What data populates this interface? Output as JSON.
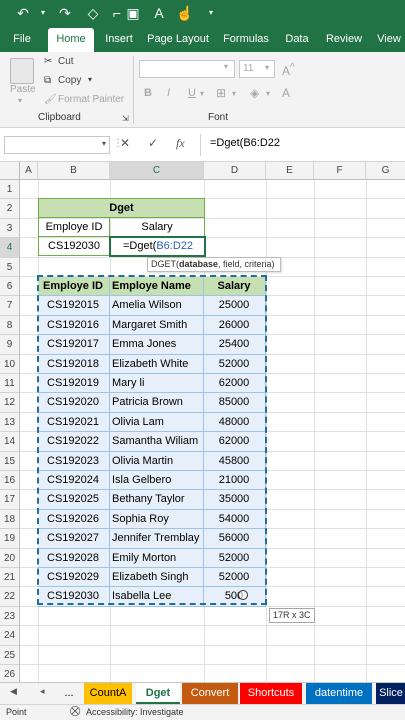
{
  "title_icons": [
    "undo-icon",
    "redo-icon",
    "eraser-icon",
    "format-painter-icon",
    "clear-formatting-icon",
    "save-icon",
    "touch-mode-icon"
  ],
  "tabs": [
    "File",
    "Home",
    "Insert",
    "Page Layout",
    "Formulas",
    "Data",
    "Review",
    "View"
  ],
  "active_tab": "Home",
  "ribbon": {
    "paste": "Paste",
    "cut": "Cut",
    "copy": "Copy",
    "format_painter": "Format Painter",
    "clipboard_label": "Clipboard",
    "font_size": "11",
    "bold": "B",
    "italic": "I",
    "underline": "U",
    "font_label": "Font"
  },
  "formula_bar": {
    "cancel": "✕",
    "enter": "✓",
    "fx": "fx",
    "value": "=Dget(B6:D22"
  },
  "columns": [
    "A",
    "B",
    "C",
    "D",
    "E",
    "F",
    "G"
  ],
  "rows": [
    "1",
    "2",
    "3",
    "4",
    "5",
    "6",
    "7",
    "8",
    "9",
    "10",
    "11",
    "12",
    "13",
    "14",
    "15",
    "16",
    "17",
    "18",
    "19",
    "20",
    "21",
    "22",
    "23",
    "24",
    "25",
    "26"
  ],
  "criteria": {
    "title": "Dget",
    "header_id": "Employe ID",
    "header_salary": "Salary",
    "id_value": "CS192030",
    "formula_prefix": "=Dget(",
    "formula_ref": "B6:D22"
  },
  "tooltip": {
    "func": "DGET(",
    "arg_bold": "database",
    "rest": ", field, criteria)"
  },
  "table": {
    "headers": [
      "Employe ID",
      "Employe Name",
      "Salary"
    ],
    "rows": [
      [
        "CS192015",
        "Amelia Wilson",
        "25000"
      ],
      [
        "CS192016",
        "Margaret Smith",
        "26000"
      ],
      [
        "CS192017",
        "Emma Jones",
        "25400"
      ],
      [
        "CS192018",
        "Elizabeth White",
        "52000"
      ],
      [
        "CS192019",
        "Mary li",
        "62000"
      ],
      [
        "CS192020",
        "Patricia Brown",
        "85000"
      ],
      [
        "CS192021",
        "Olivia Lam",
        "48000"
      ],
      [
        "CS192022",
        "Samantha Wiliam",
        "62000"
      ],
      [
        "CS192023",
        "Olivia Martin",
        "45800"
      ],
      [
        "CS192024",
        "Isla Gelbero",
        "21000"
      ],
      [
        "CS192025",
        "Bethany Taylor",
        "35000"
      ],
      [
        "CS192026",
        "Sophia Roy",
        "54000"
      ],
      [
        "CS192027",
        "Jennifer Tremblay",
        "56000"
      ],
      [
        "CS192028",
        "Emily Morton",
        "52000"
      ],
      [
        "CS192029",
        "Elizabeth Singh",
        "52000"
      ],
      [
        "CS192030",
        "Isabella Lee",
        "500"
      ]
    ]
  },
  "selection_size": "17R x 3C",
  "sheet_tabs": [
    {
      "label": "...",
      "color": "#f3f3f3",
      "text": "#000000"
    },
    {
      "label": "CountA",
      "color": "#ffc000",
      "text": "#000000"
    },
    {
      "label": "Dget",
      "color": "#ffffff",
      "text": "#000000",
      "active": true
    },
    {
      "label": "Convert",
      "color": "#c55a11",
      "text": "#ffffff"
    },
    {
      "label": "Shortcuts",
      "color": "#ff0000",
      "text": "#ffffff"
    },
    {
      "label": "datentime",
      "color": "#0070c0",
      "text": "#ffffff"
    },
    {
      "label": "Slice",
      "color": "#002060",
      "text": "#ffffff"
    }
  ],
  "status": {
    "mode": "Point",
    "accessibility": "Accessibility: Investigate"
  },
  "colors": {
    "excel_green": "#217346",
    "header_fill": "#c6e0b4",
    "cell_border": "#70ad47",
    "selection_dash": "#1f6e9c",
    "ref_blue": "#2f5fb3"
  }
}
